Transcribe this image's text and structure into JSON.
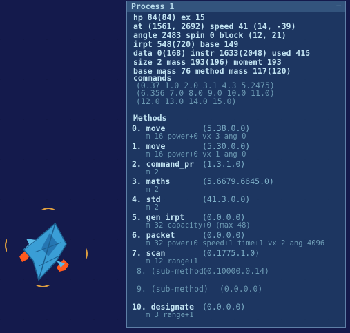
{
  "panel": {
    "title": "Process 1",
    "close_glyph": "—"
  },
  "stats": [
    "hp 84(84) ex 15",
    "at (1561, 2692) speed 41 (14, -39)",
    "angle 2483 spin 0 block (12, 21)",
    "irpt 548(720) base 149",
    "data 0(168) instr 1633(2048) used 415",
    "size 2 mass 193(196) moment 193",
    "base mass 76 method mass 117(120)",
    "commands"
  ],
  "commands": [
    "(0.37 1.0 2.0 3.1 4.3 5.2475)",
    "(6.356 7.0 8.0 9.0 10.0 11.0)",
    "(12.0 13.0 14.0 15.0)"
  ],
  "methods_header": "Methods",
  "methods": [
    {
      "name": "0. move",
      "values": "(5.38.0.0)",
      "detail": "m 16 power+0 vx 3 ang 0"
    },
    {
      "name": "1. move",
      "values": "(5.30.0.0)",
      "detail": "m 16 power+0 vx 1 ang 0"
    },
    {
      "name": "2. command_pr",
      "values": "(1.3.1.0)",
      "detail": "m 2"
    },
    {
      "name": "3. maths",
      "values": "(5.6679.6645.0)",
      "detail": "m 2"
    },
    {
      "name": "4. std",
      "values": "(41.3.0.0)",
      "detail": "m 2"
    },
    {
      "name": "5. gen irpt",
      "values": "(0.0.0.0)",
      "detail": "m 32 capacity+0 (max 48)"
    },
    {
      "name": "6. packet",
      "values": "(0.0.0.0)",
      "detail": "m 32 power+0 speed+1 time+1 vx 2 ang 4096"
    },
    {
      "name": "7. scan",
      "values": "(0.1775.1.0)",
      "detail": "m 12 range+1"
    },
    {
      "name": "8. (sub-method)",
      "values": "(0.10000.0.14)",
      "detail": ""
    },
    {
      "name": "9. (sub-method)",
      "values": "(0.0.0.0)",
      "detail": ""
    },
    {
      "name": "10. designate",
      "values": "(0.0.0.0)",
      "detail": "m 3 range+1"
    }
  ],
  "colors": {
    "background": "#141a4c",
    "panel": "#24486e",
    "text": "#c2e4f2",
    "ship": "#3a9ed6",
    "thruster": "#ff5a1e",
    "orbit_marker": "#e0a040"
  }
}
